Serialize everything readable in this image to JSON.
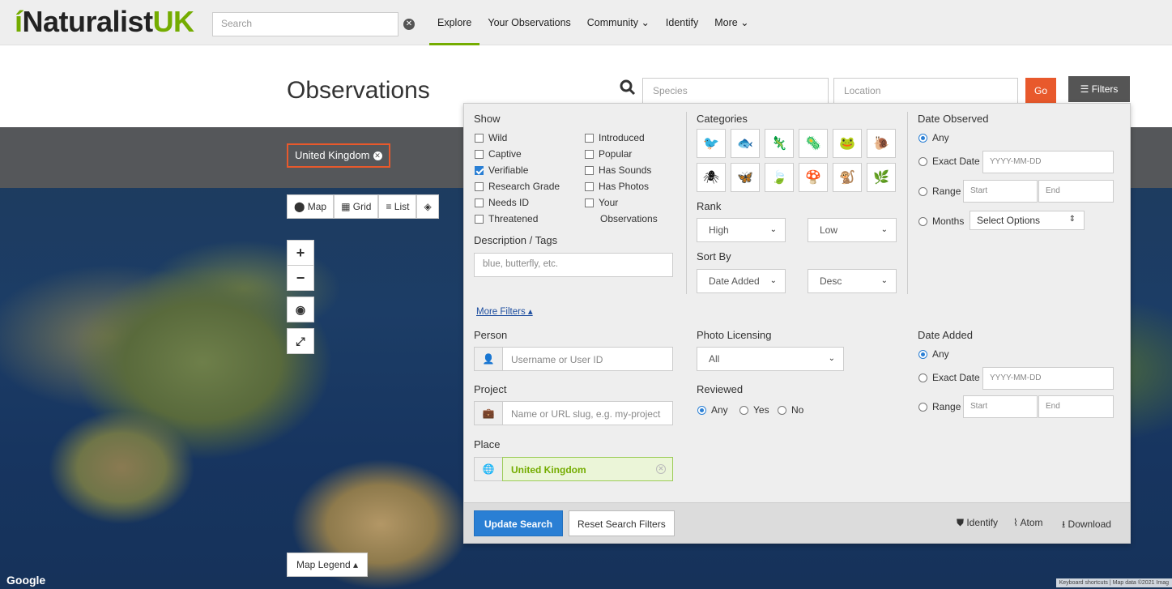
{
  "header": {
    "logo_i": "í",
    "logo_main": "Naturalist",
    "logo_uk": "UK",
    "search_placeholder": "Search",
    "nav": [
      "Explore",
      "Your Observations",
      "Community ⌄",
      "Identify",
      "More ⌄"
    ]
  },
  "page": {
    "title": "Observations",
    "species_placeholder": "Species",
    "location_placeholder": "Location",
    "go_label": "Go",
    "filters_label": "Filters"
  },
  "map": {
    "place_label": "United Kingdom",
    "view_tabs": [
      "Map",
      "Grid",
      "List"
    ],
    "zoom_in": "+",
    "zoom_out": "−",
    "legend_label": "Map Legend ▴",
    "google_label": "Google",
    "attribution": "Keyboard shortcuts   |   Map data ©2021 Imag"
  },
  "filters": {
    "show_title": "Show",
    "show_left": [
      {
        "label": "Wild",
        "checked": false
      },
      {
        "label": "Captive",
        "checked": false
      },
      {
        "label": "Verifiable",
        "checked": true
      },
      {
        "label": "Research Grade",
        "checked": false
      },
      {
        "label": "Needs ID",
        "checked": false
      },
      {
        "label": "Threatened",
        "checked": false
      }
    ],
    "show_right": [
      {
        "label": "Introduced",
        "checked": false
      },
      {
        "label": "Popular",
        "checked": false
      },
      {
        "label": "Has Sounds",
        "checked": false
      },
      {
        "label": "Has Photos",
        "checked": false
      },
      {
        "label": "Your",
        "checked": false
      }
    ],
    "show_right_extra": "Observations",
    "desc_title": "Description / Tags",
    "desc_placeholder": "blue, butterfly, etc.",
    "categories_title": "Categories",
    "categories": [
      "🐦",
      "🐟",
      "🦎",
      "🦠",
      "🐸",
      "🐌",
      "🕷",
      "🦋",
      "🍃",
      "🍄",
      "🐒",
      "🌿"
    ],
    "rank_title": "Rank",
    "rank_high": "High",
    "rank_low": "Low",
    "sort_title": "Sort By",
    "sort_by": "Date Added",
    "sort_dir": "Desc",
    "date_obs_title": "Date Observed",
    "date_any": "Any",
    "date_exact": "Exact Date",
    "date_placeholder": "YYYY-MM-DD",
    "date_range": "Range",
    "date_start": "Start",
    "date_end": "End",
    "date_months": "Months",
    "months_select": "Select Options",
    "more_filters": "More Filters ▴",
    "person_title": "Person",
    "person_placeholder": "Username or User ID",
    "project_title": "Project",
    "project_placeholder": "Name or URL slug, e.g. my-project",
    "place_title": "Place",
    "place_value": "United Kingdom",
    "photo_title": "Photo Licensing",
    "photo_value": "All",
    "reviewed_title": "Reviewed",
    "reviewed_any": "Any",
    "reviewed_yes": "Yes",
    "reviewed_no": "No",
    "date_added_title": "Date Added",
    "update_btn": "Update Search",
    "reset_btn": "Reset Search Filters",
    "identify_link": "Identify",
    "atom_link": "Atom",
    "download_link": "Download"
  }
}
